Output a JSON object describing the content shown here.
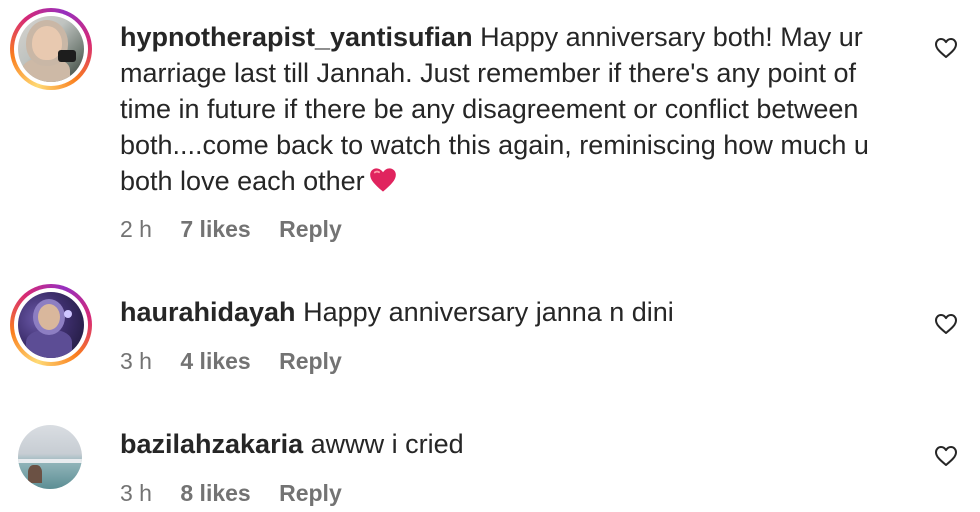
{
  "comments": [
    {
      "username": "hypnotherapist_yantisufian",
      "text": "Happy anniversary both! May ur marriage last till Jannah. Just remember if there's any point of time in future if there be any disagreement or conflict between both....come back to watch this again, reminiscing how much u both love each other",
      "emoji": "red-heart-emoji",
      "time": "2 h",
      "likes": "7 likes",
      "reply": "Reply",
      "avatar_story_ring": true
    },
    {
      "username": "haurahidayah",
      "text": "Happy anniversary janna n dini",
      "time": "3 h",
      "likes": "4 likes",
      "reply": "Reply",
      "avatar_story_ring": true
    },
    {
      "username": "bazilahzakaria",
      "text": "awww i cried",
      "time": "3 h",
      "likes": "8 likes",
      "reply": "Reply",
      "avatar_story_ring": false
    }
  ],
  "icons": {
    "like": "heart-outline-icon"
  },
  "colors": {
    "text": "#262626",
    "meta": "#737373",
    "emoji_heart": "#e0245e"
  }
}
